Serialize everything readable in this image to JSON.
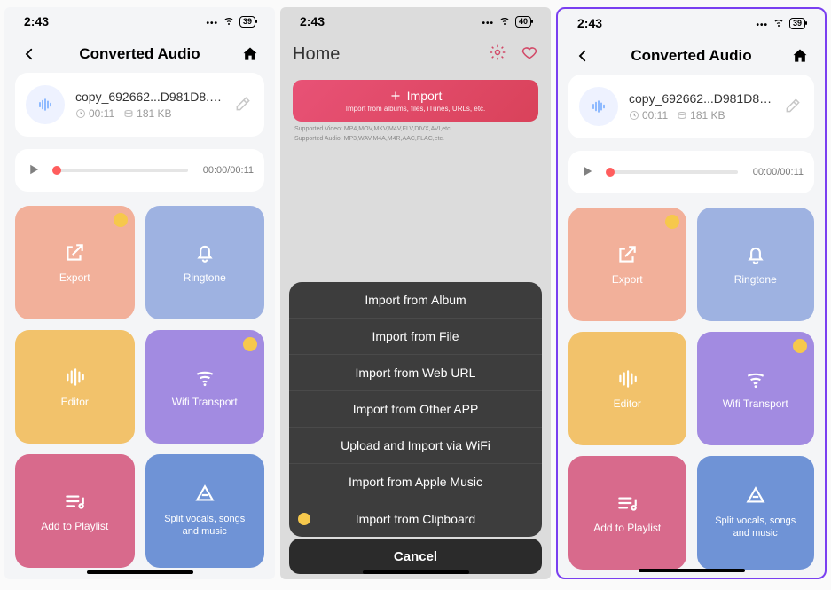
{
  "status": {
    "time": "2:43",
    "battery1": "39",
    "battery2": "40",
    "battery3": "39"
  },
  "screenA": {
    "title": "Converted Audio",
    "file_name": "copy_692662...D981D8.m4a",
    "duration": "00:11",
    "size": "181 KB",
    "player_time": "00:00/00:11"
  },
  "tiles": {
    "export": "Export",
    "ringtone": "Ringtone",
    "editor": "Editor",
    "wifi": "Wifi Transport",
    "playlist": "Add to Playlist",
    "split": "Split vocals, songs and music"
  },
  "screenB": {
    "title": "Home",
    "import_label": "Import",
    "import_sub": "Import from albums, files, iTunes, URLs, etc.",
    "hint_video": "Supported Video: MP4,MOV,MKV,M4V,FLV,DIVX,AVI,etc.",
    "hint_audio": "Supported Audio: MP3,WAV,M4A,M4R,AAC,FLAC,etc.",
    "sheet": [
      "Import from Album",
      "Import from File",
      "Import from Web URL",
      "Import from Other APP",
      "Upload and Import via WiFi",
      "Import from Apple Music",
      "Import from Clipboard"
    ],
    "cancel": "Cancel"
  }
}
